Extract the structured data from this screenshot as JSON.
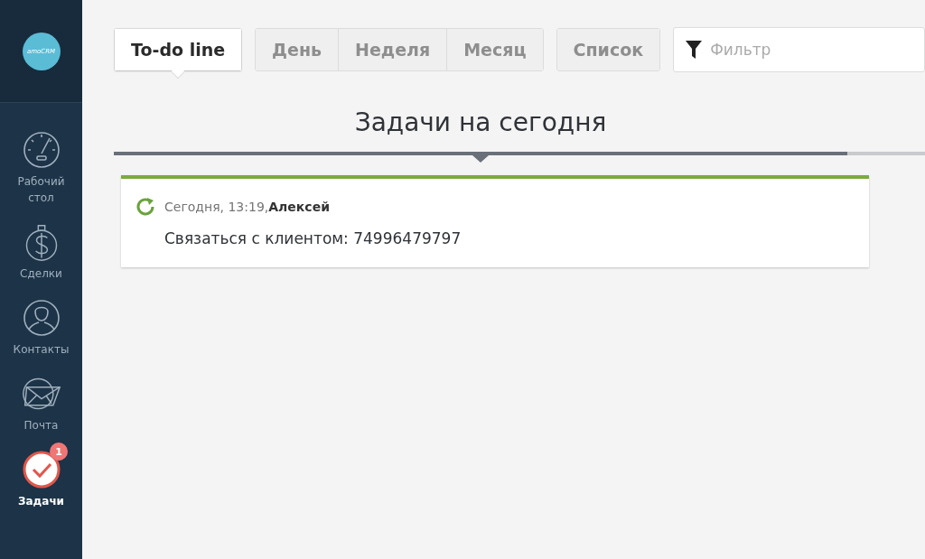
{
  "sidebar": {
    "logo": "amoCRM",
    "items": [
      {
        "kind": "dashboard",
        "label": "Рабочий стол",
        "selected": false
      },
      {
        "kind": "deals",
        "label": "Сделки",
        "selected": false
      },
      {
        "kind": "contacts",
        "label": "Контакты",
        "selected": false
      },
      {
        "kind": "mail",
        "label": "Почта",
        "selected": false
      },
      {
        "kind": "tasks",
        "label": "Задачи",
        "selected": true,
        "badge": "1"
      }
    ]
  },
  "view_groups": [
    [
      {
        "label": "To-do line",
        "selected": true
      }
    ],
    [
      {
        "label": "День",
        "selected": false
      },
      {
        "label": "Неделя",
        "selected": false
      },
      {
        "label": "Месяц",
        "selected": false
      }
    ],
    [
      {
        "label": "Список",
        "selected": false
      }
    ]
  ],
  "filter": {
    "placeholder": "Фильтр"
  },
  "section_title": "Задачи на сегодня",
  "tasks": [
    {
      "meta": "Сегодня, 13:19,**Алексей**",
      "text": "Связаться с клиентом: 74996479797"
    }
  ]
}
